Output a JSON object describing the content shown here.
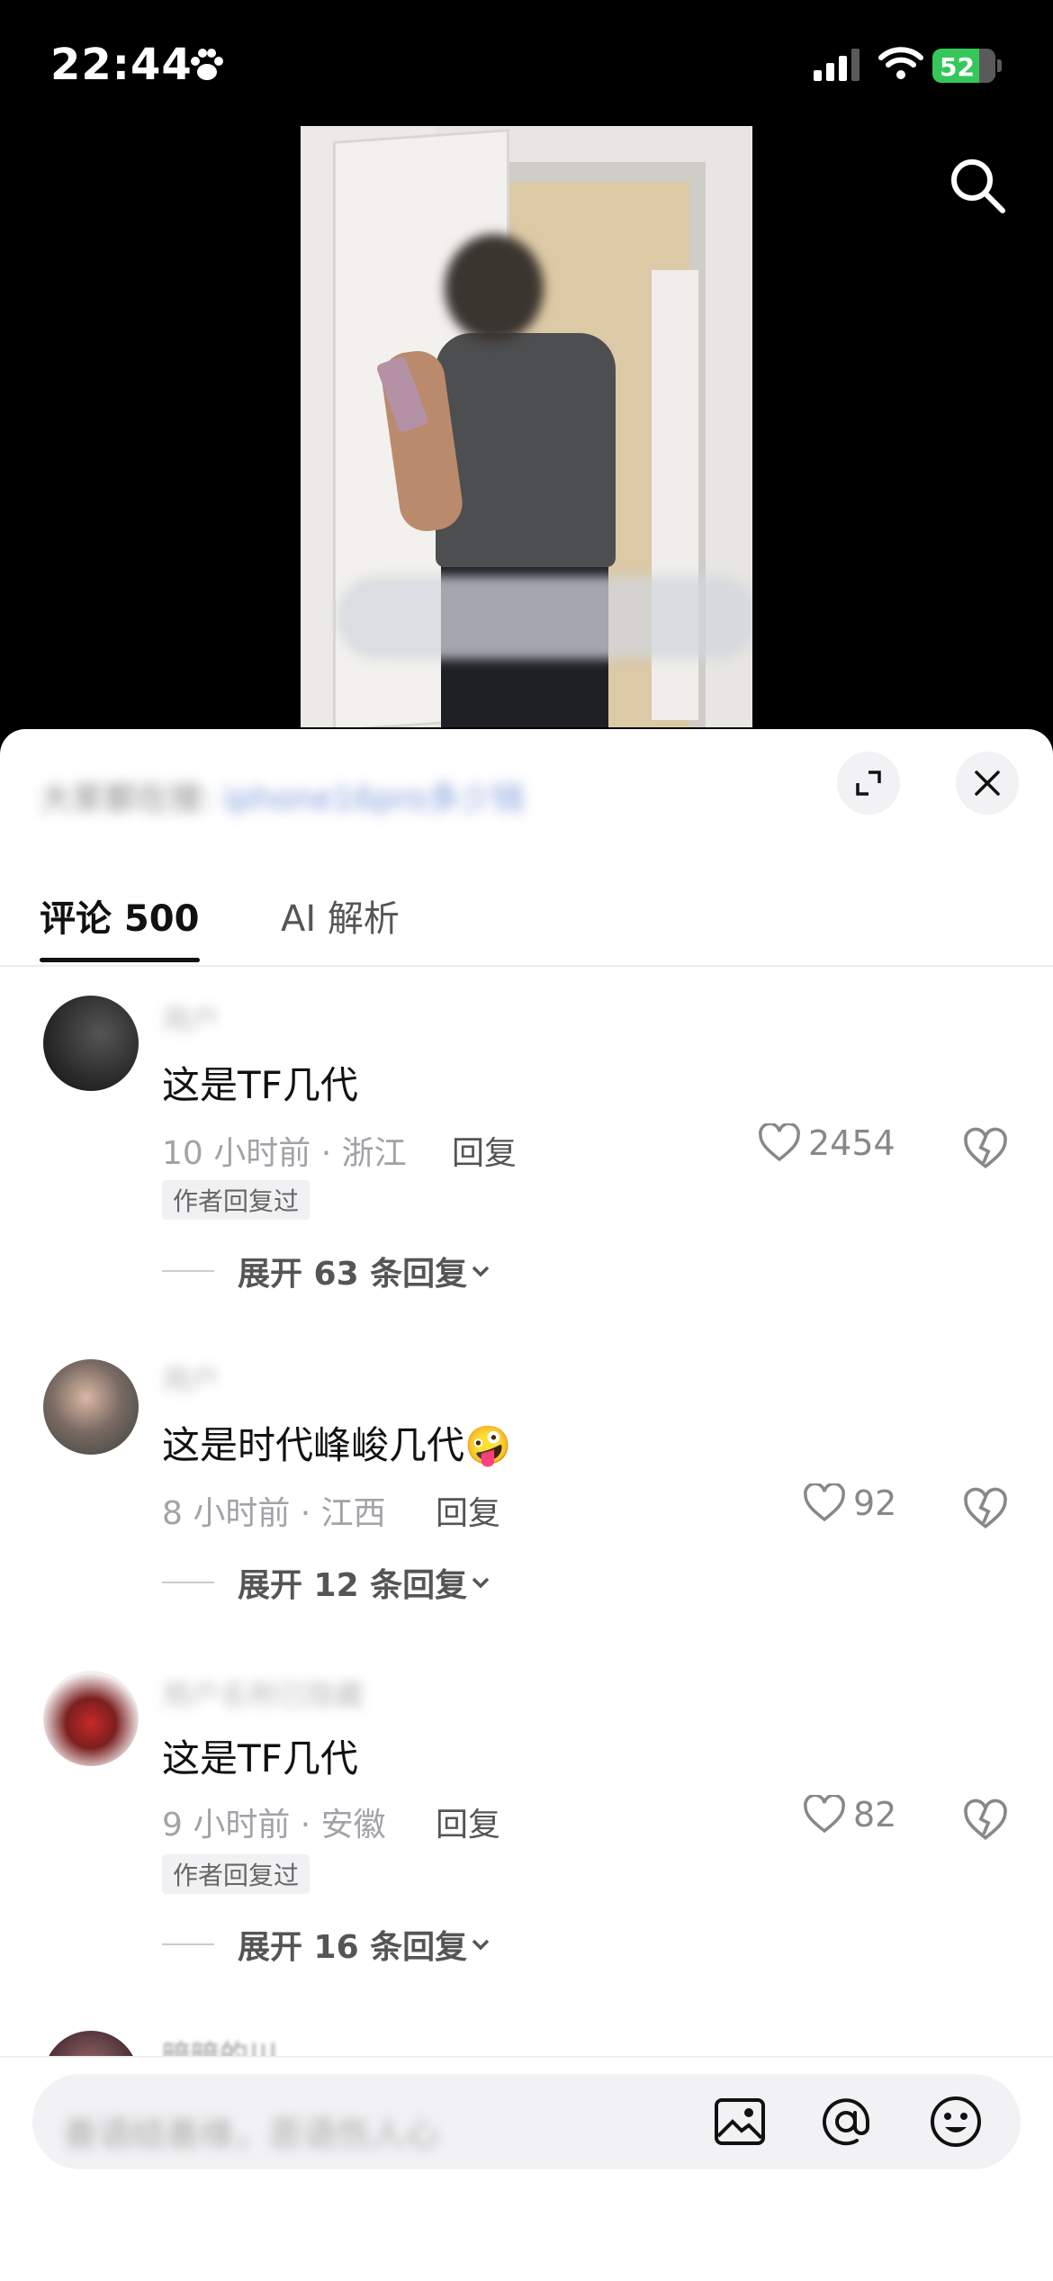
{
  "status_bar": {
    "time": "22:44",
    "battery": "52"
  },
  "video": {
    "overlay_caption": ""
  },
  "sheet": {
    "title_prefix": "大家都在搜:",
    "title_query": "iphone16pro多少钱"
  },
  "tabs": [
    {
      "label": "评论 500",
      "active": true
    },
    {
      "label": "AI 解析",
      "active": false
    }
  ],
  "comments": [
    {
      "username": "用户",
      "text": "这是TF几代",
      "time_location": "10 小时前 · 浙江",
      "reply_label": "回复",
      "likes": "2454",
      "author_replied": "作者回复过",
      "expand": "展开 63 条回复"
    },
    {
      "username": "用户",
      "text": "这是时代峰峻几代",
      "time_location": "8 小时前 · 江西",
      "reply_label": "回复",
      "likes": "92",
      "expand": "展开 12 条回复"
    },
    {
      "username": "用户名称已隐藏",
      "text": "这是TF几代",
      "time_location": "9 小时前 · 安徽",
      "reply_label": "回复",
      "likes": "82",
      "author_replied": "作者回复过",
      "expand": "展开 16 条回复"
    },
    {
      "username": "暗暗的川"
    }
  ],
  "input": {
    "placeholder": "善语结善缘，恶语伤人心"
  },
  "colors": {
    "accent_battery": "#35c759",
    "sheet_bg": "#ffffff",
    "text": "#111111",
    "muted": "#a2a2a8"
  }
}
